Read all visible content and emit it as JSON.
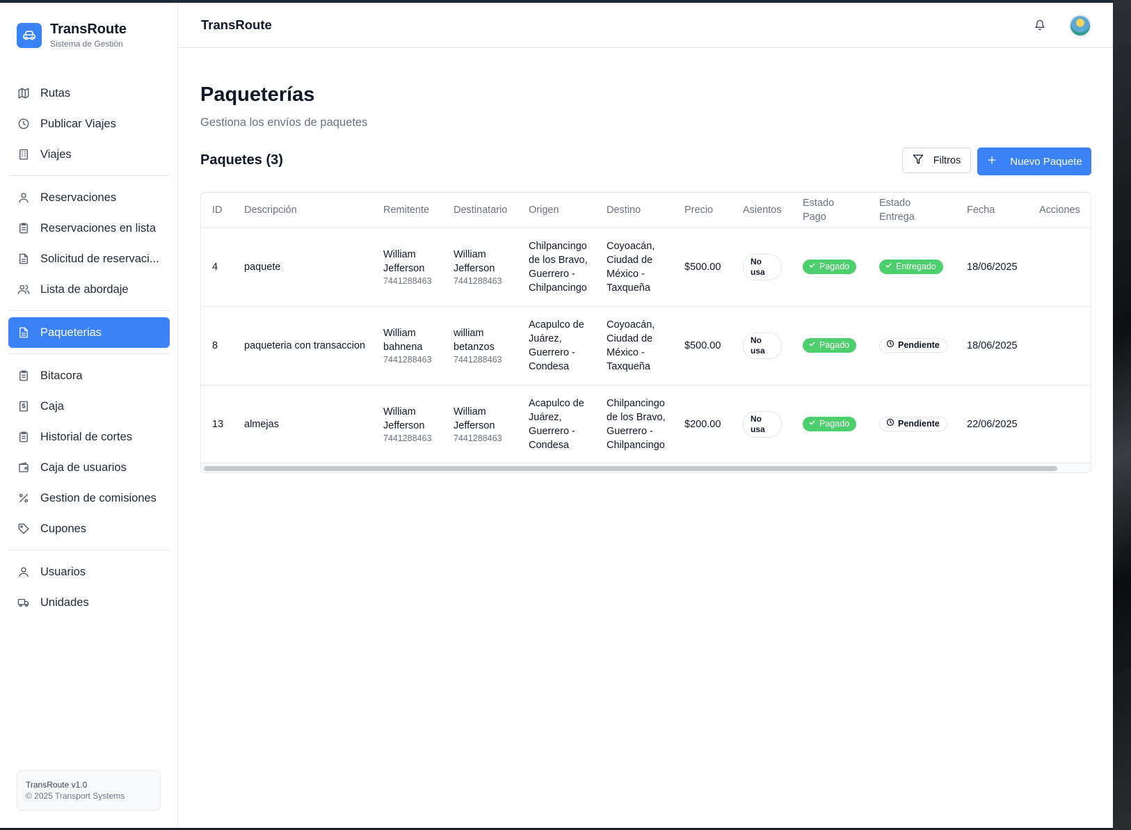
{
  "app": {
    "brand_title": "TransRoute",
    "brand_subtitle": "Sistema de Gestión",
    "topbar_title": "TransRoute",
    "accent_color": "#3b82f6",
    "success_color": "#4ccf6c"
  },
  "sidebar": {
    "groups": [
      [
        {
          "label": "Rutas",
          "icon": "map-icon"
        },
        {
          "label": "Publicar Viajes",
          "icon": "clock-icon"
        },
        {
          "label": "Viajes",
          "icon": "building-icon"
        }
      ],
      [
        {
          "label": "Reservaciones",
          "icon": "user-icon"
        },
        {
          "label": "Reservaciones en lista",
          "icon": "clipboard-list-icon"
        },
        {
          "label": "Solicitud de reservaci...",
          "icon": "file-text-icon"
        },
        {
          "label": "Lista de abordaje",
          "icon": "users-icon"
        }
      ],
      [
        {
          "label": "Paqueterias",
          "icon": "file-text-icon",
          "active": true
        }
      ],
      [
        {
          "label": "Bitacora",
          "icon": "clipboard-list-icon"
        },
        {
          "label": "Caja",
          "icon": "receipt-dollar-icon"
        },
        {
          "label": "Historial de cortes",
          "icon": "clipboard-list-icon"
        },
        {
          "label": "Caja de usuarios",
          "icon": "wallet-icon"
        },
        {
          "label": "Gestion de comisiones",
          "icon": "percent-icon"
        },
        {
          "label": "Cupones",
          "icon": "tag-icon"
        }
      ],
      [
        {
          "label": "Usuarios",
          "icon": "user-icon"
        },
        {
          "label": "Unidades",
          "icon": "truck-icon"
        }
      ]
    ],
    "version": "TransRoute v1.0",
    "copyright": "© 2025 Transport Systems"
  },
  "page": {
    "title": "Paqueterías",
    "subtitle": "Gestiona los envíos de paquetes",
    "section_title": "Paquetes (3)",
    "filter_label": "Filtros",
    "new_label": "Nuevo Paquete"
  },
  "table": {
    "headers": [
      "ID",
      "Descripción",
      "Remitente",
      "Destinatario",
      "Origen",
      "Destino",
      "Precio",
      "Asientos",
      "Estado Pago",
      "Estado Entrega",
      "Fecha",
      "Acciones"
    ],
    "rows": [
      {
        "id": "4",
        "descripcion": "paquete",
        "remitente": "William Jefferson",
        "remitente_tel": "7441288463",
        "destinatario": "William Jefferson",
        "destinatario_tel": "7441288463",
        "origen": "Chilpancingo de los Bravo, Guerrero - Chilpancingo",
        "destino": "Coyoacán, Ciudad de México - Taxqueña",
        "precio": "$500.00",
        "asientos": "No usa",
        "estado_pago": "Pagado",
        "estado_entrega": "Entregado",
        "estado_entrega_type": "done",
        "fecha": "18/06/2025"
      },
      {
        "id": "8",
        "descripcion": "paqueteria con transaccion",
        "remitente": "William bahnena",
        "remitente_tel": "7441288463",
        "destinatario": "william betanzos",
        "destinatario_tel": "7441288463",
        "origen": "Acapulco de Juárez, Guerrero - Condesa",
        "destino": "Coyoacán, Ciudad de México - Taxqueña",
        "precio": "$500.00",
        "asientos": "No usa",
        "estado_pago": "Pagado",
        "estado_entrega": "Pendiente",
        "estado_entrega_type": "pending",
        "fecha": "18/06/2025"
      },
      {
        "id": "13",
        "descripcion": "almejas",
        "remitente": "William Jefferson",
        "remitente_tel": "7441288463",
        "destinatario": "William Jefferson",
        "destinatario_tel": "7441288463",
        "origen": "Acapulco de Juárez, Guerrero - Condesa",
        "destino": "Chilpancingo de los Bravo, Guerrero - Chilpancingo",
        "precio": "$200.00",
        "asientos": "No usa",
        "estado_pago": "Pagado",
        "estado_entrega": "Pendiente",
        "estado_entrega_type": "pending",
        "fecha": "22/06/2025"
      }
    ]
  }
}
